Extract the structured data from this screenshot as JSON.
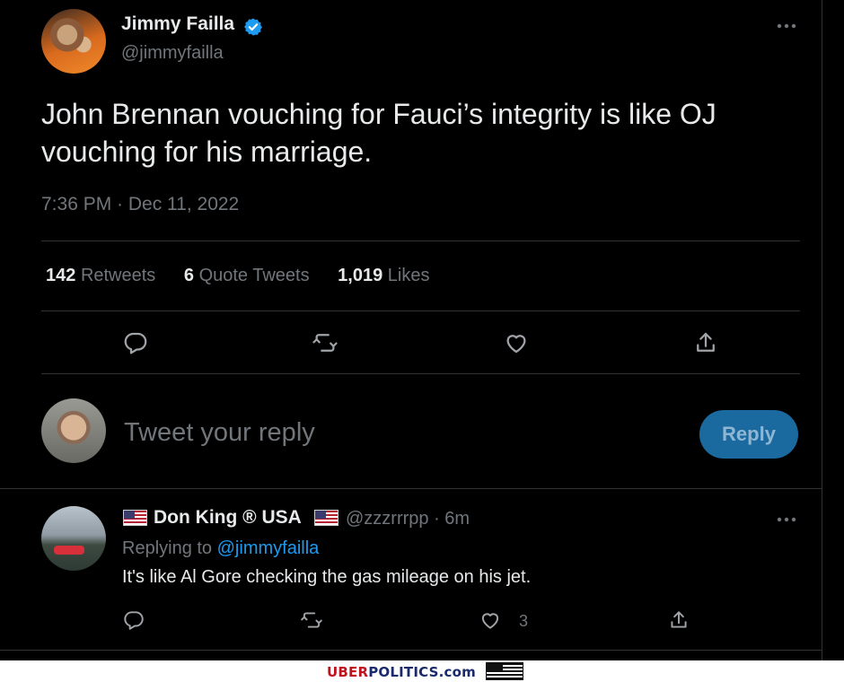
{
  "tweet": {
    "author_name": "Jimmy Failla",
    "author_handle": "@jimmyfailla",
    "text": "John Brennan vouching for Fauci’s integrity is like OJ vouching for his marriage.",
    "timestamp": "7:36 PM · Dec 11, 2022",
    "stats": [
      {
        "count": "142",
        "label": "Retweets"
      },
      {
        "count": "6",
        "label": "Quote Tweets"
      },
      {
        "count": "1,019",
        "label": "Likes"
      }
    ],
    "icons": {
      "verified": "verified-badge-icon",
      "more": "more-options-icon",
      "reply": "reply-icon",
      "retweet": "retweet-icon",
      "like": "heart-icon",
      "share": "share-icon"
    }
  },
  "composer": {
    "placeholder": "Tweet your reply",
    "button_label": "Reply"
  },
  "reply": {
    "author_name": "Don King ® USA",
    "handle_time": "@zzzrrrpp · 6m",
    "replying_prefix": "Replying to ",
    "replying_to": "@jimmyfailla",
    "text": "It's like Al Gore checking the gas mileage on his jet.",
    "like_count": "3"
  },
  "footer": {
    "brand_first": "UBER",
    "brand_second": "POLITICS.com"
  },
  "colors": {
    "background": "#000000",
    "text": "#e7e9ea",
    "muted": "#71767b",
    "accent": "#1d9bf0",
    "divider": "#2f3336",
    "reply_button": "#1a6aa0"
  }
}
